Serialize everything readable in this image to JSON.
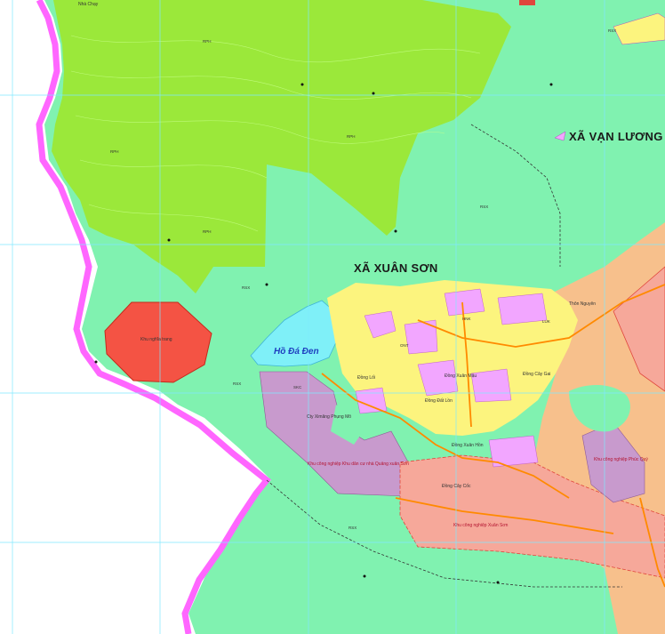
{
  "labels": {
    "xa_van_luong": "XÃ VẠN LƯƠNG",
    "xa_xuan_son": "XÃ XUÂN SƠN",
    "ho_da_den": "Hồ Đá Đen",
    "dong_cay_coc": "Đồng Cây Cốc",
    "dong_xuan_hon": "Đồng Xuân Hồn",
    "dong_cay_gai": "Đồng Cây Gai",
    "dong_loi": "Đồng Lối",
    "dong_xuan_mau": "Đồng Xuân Mậu",
    "dong_dat_lon": "Đồng Đất Lồn",
    "thon_nguyen": "Thôn Nguyên",
    "cty_xim_khong": "Cty Ximăng Phụng Mô",
    "khu_nghia_trang": "Khu nghĩa trang",
    "kcn_label": "Khu công nghiệp Xuân Sơn",
    "ccn_label": "Khu công nghiệp Khu dân cư nhà Quảng xuân Sơn",
    "cum_label": "Khu công nghiệp Phúc Quý",
    "rph": "RPH",
    "rsx": "RSX",
    "luk": "LUK",
    "hnk": "HNK",
    "onr": "ONT",
    "skc": "SKC",
    "nhu_chay": "Nhà Chạy"
  },
  "colors": {
    "production_forest": "#80f2b0",
    "protection_forest": "#9be83a",
    "industrial": "#f6a89a",
    "mining": "#c89acd",
    "residential": "#f2a6ff",
    "rice": "#fcf47e",
    "urban_orange": "#f7c08c",
    "water": "#7ff0f8",
    "cemetery": "#f45344",
    "boundary": "#ff66ff",
    "road": "#ff8a00",
    "grid": "#7fe8ff"
  }
}
